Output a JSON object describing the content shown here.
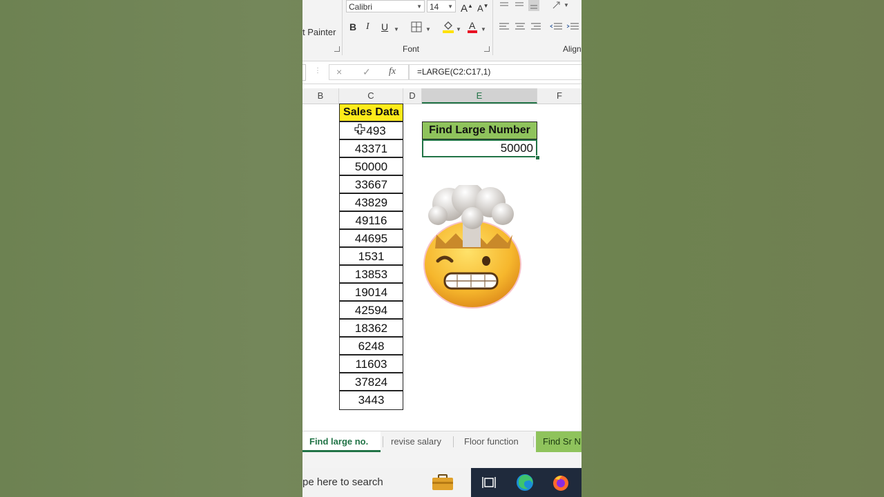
{
  "ribbon": {
    "font_name": "Calibri",
    "font_size": "14",
    "format_painter_label": "t Painter",
    "font_group_label": "Font",
    "alignment_group_label": "Align",
    "bold_label": "B",
    "italic_label": "I",
    "underline_label": "U"
  },
  "formula_bar": {
    "cancel_icon": "×",
    "enter_icon": "✓",
    "fx_label": "fx",
    "formula": "=LARGE(C2:C17,1)"
  },
  "columns": [
    "B",
    "C",
    "D",
    "E",
    "F"
  ],
  "selected_column": "E",
  "sheet": {
    "sales_header": "Sales Data",
    "sales_values": [
      "4 493",
      "43371",
      "50000",
      "33667",
      "43829",
      "49116",
      "44695",
      "1531",
      "13853",
      "19014",
      "42594",
      "18362",
      "6248",
      "11603",
      "37824",
      "3443"
    ],
    "find_header": "Find Large Number",
    "find_result": "50000"
  },
  "tabs": [
    {
      "label": "Find large no.",
      "active": true
    },
    {
      "label": "revise salary",
      "active": false
    },
    {
      "label": "Floor function",
      "active": false
    },
    {
      "label": "Find Sr N",
      "active": false
    }
  ],
  "taskbar": {
    "search_text": "pe here to search"
  },
  "colors": {
    "excel_green": "#217346",
    "sales_header_bg": "#ffeb1a",
    "find_header_bg": "#8fc35c",
    "background": "#6f8352"
  }
}
